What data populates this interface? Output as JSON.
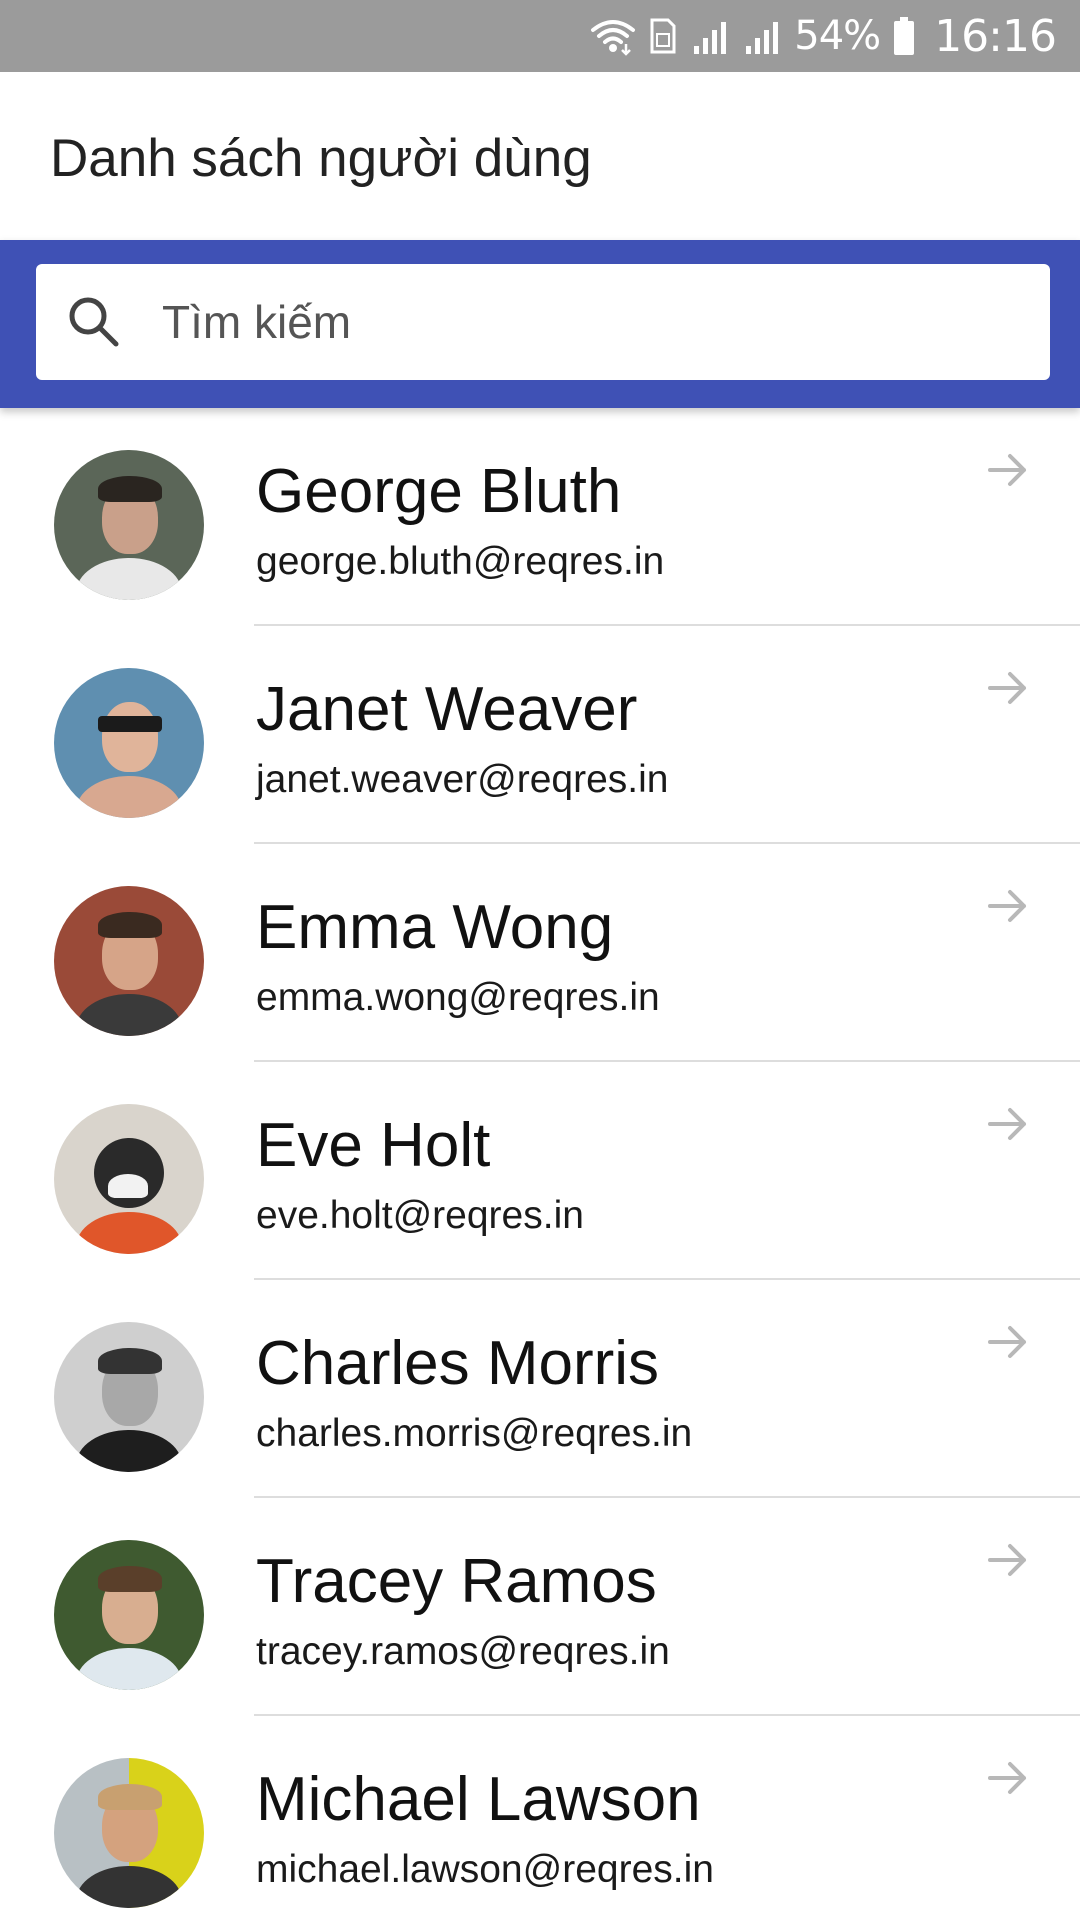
{
  "status_bar": {
    "battery_text": "54%",
    "time": "16:16",
    "icons": [
      "wifi-icon",
      "sim-icon",
      "signal-icon",
      "signal-icon",
      "battery-icon"
    ]
  },
  "header": {
    "title": "Danh sách người dùng"
  },
  "search": {
    "placeholder": "Tìm kiếm",
    "value": "",
    "icon": "search-icon"
  },
  "colors": {
    "status_bar": "#9b9b9b",
    "accent": "#3f51b5",
    "divider": "#dddddd",
    "arrow": "#b8b8b8"
  },
  "users": [
    {
      "name": "George Bluth",
      "email": "george.bluth@reqres.in",
      "avatar": "photo-avatar"
    },
    {
      "name": "Janet Weaver",
      "email": "janet.weaver@reqres.in",
      "avatar": "photo-avatar"
    },
    {
      "name": "Emma Wong",
      "email": "emma.wong@reqres.in",
      "avatar": "photo-avatar"
    },
    {
      "name": "Eve Holt",
      "email": "eve.holt@reqres.in",
      "avatar": "photo-avatar"
    },
    {
      "name": "Charles Morris",
      "email": "charles.morris@reqres.in",
      "avatar": "photo-avatar"
    },
    {
      "name": "Tracey Ramos",
      "email": "tracey.ramos@reqres.in",
      "avatar": "photo-avatar"
    },
    {
      "name": "Michael Lawson",
      "email": "michael.lawson@reqres.in",
      "avatar": "photo-avatar"
    }
  ]
}
